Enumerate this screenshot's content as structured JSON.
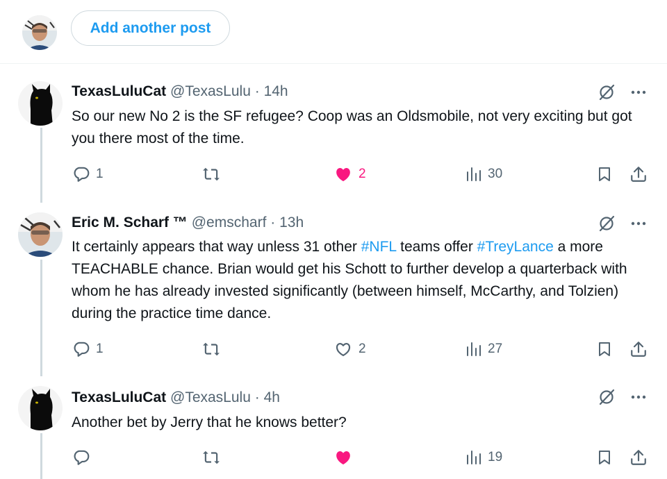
{
  "compose": {
    "add_post_label": "Add another post"
  },
  "posts": [
    {
      "author_name": "TexasLuluCat",
      "handle": "@TexasLulu",
      "separator": "·",
      "time": "14h",
      "text": "So our new No 2 is the SF refugee?  Coop was an Oldsmobile, not very exciting but got you there most of the time.",
      "replies": "1",
      "reposts": "",
      "likes": "2",
      "liked": true,
      "views": "30"
    },
    {
      "author_name": "Eric M. Scharf ™",
      "handle": "@emscharf",
      "separator": "·",
      "time": "13h",
      "text_before": "It certainly appears that way unless 31 other ",
      "hashtag1": "#NFL",
      "text_middle": " teams offer ",
      "hashtag2": "#TreyLance",
      "text_after": " a more TEACHABLE chance. Brian would get his Schott to further develop a quarterback with whom he has already invested significantly (between himself, McCarthy, and Tolzien) during the practice time dance.",
      "replies": "1",
      "reposts": "",
      "likes": "2",
      "liked": false,
      "views": "27"
    },
    {
      "author_name": "TexasLuluCat",
      "handle": "@TexasLulu",
      "separator": "·",
      "time": "4h",
      "text": "Another bet by Jerry that he knows better?",
      "replies": "",
      "reposts": "",
      "likes": "",
      "liked": true,
      "views": "19"
    }
  ],
  "colors": {
    "accent": "#1d9bf0",
    "like": "#f91880",
    "muted": "#536471",
    "text": "#0f1419"
  },
  "icons": [
    "grok-slash-icon",
    "more-icon",
    "reply-icon",
    "repost-icon",
    "like-icon",
    "views-icon",
    "bookmark-icon",
    "share-icon"
  ]
}
